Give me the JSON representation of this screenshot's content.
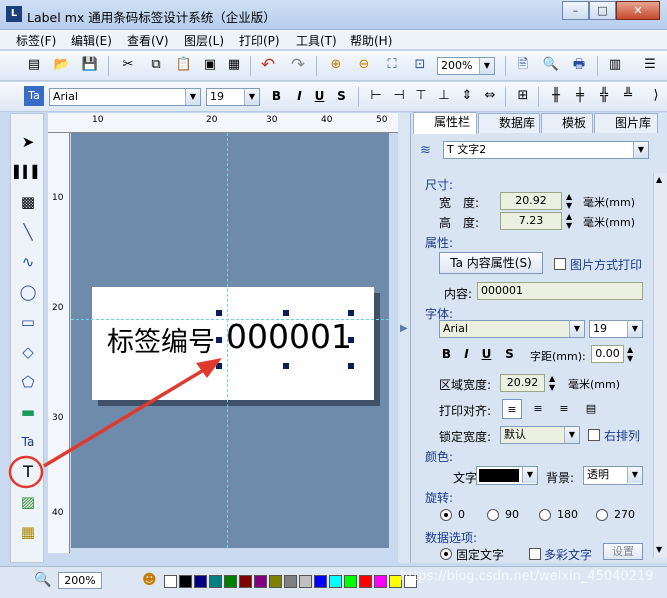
{
  "window": {
    "title": "Label mx 通用条码标签设计系统（企业版）",
    "min": "–",
    "max": "□",
    "close": "✕"
  },
  "menu": [
    "标签(F)",
    "编辑(E)",
    "查看(V)",
    "图层(L)",
    "打印(P)",
    "工具(T)",
    "帮助(H)"
  ],
  "toolbar1": {
    "zoom_value": "200%"
  },
  "toolbar2": {
    "font_name": "Arial",
    "font_size": "19",
    "bold": "B",
    "italic": "I",
    "underline": "U",
    "strike": "S"
  },
  "ruler_top": [
    "10",
    "20",
    "30",
    "40",
    "50"
  ],
  "ruler_left": [
    "10",
    "20",
    "30",
    "40"
  ],
  "canvas": {
    "static_text": "标签编号",
    "variable_text": "000001"
  },
  "panel": {
    "tabs": [
      "属性栏",
      "数据库",
      "模板",
      "图片库"
    ],
    "object_select": "T 文字2",
    "size_section": "尺寸:",
    "width_label": "宽　度:",
    "width_value": "20.92",
    "height_label": "高　度:",
    "height_value": "7.23",
    "unit": "毫米(mm)",
    "attr_section": "属性:",
    "content_btn": "内容属性(S)",
    "image_mode": "图片方式打印",
    "content_label": "内容:",
    "content_value": "000001",
    "font_section": "字体:",
    "font_name": "Arial",
    "font_size": "19",
    "spacing_label": "字距(mm):",
    "spacing_value": "0.00",
    "area_width_label": "区域宽度:",
    "area_width_value": "20.92",
    "area_unit": "毫米(mm)",
    "align_label": "打印对齐:",
    "lock_label": "锁定宽度:",
    "lock_value": "默认",
    "rtl_label": "右排列",
    "color_section": "颜色:",
    "text_color_label": "文字:",
    "bg_label": "背景:",
    "bg_value": "透明",
    "rotate_section": "旋转:",
    "rotations": [
      "0",
      "90",
      "180",
      "270"
    ],
    "data_section": "数据选项:",
    "fixed_text": "固定文字",
    "multi_text": "多彩文字",
    "settings_btn": "设置"
  },
  "status": {
    "zoom": "200%",
    "watermark": "https://blog.csdn.net/weixin_45040219"
  },
  "colors": {
    "text_color": "#000000",
    "accent": "#e03a2f"
  }
}
